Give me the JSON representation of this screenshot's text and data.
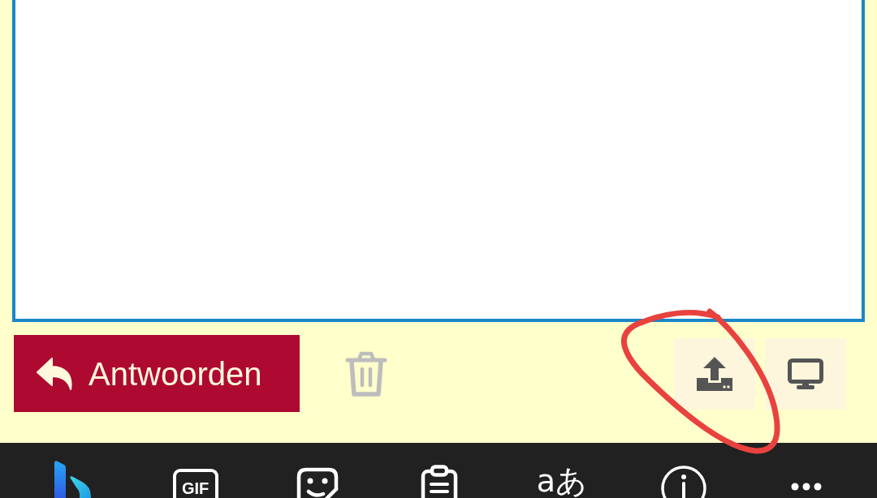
{
  "message_field": {
    "focused": true
  },
  "actions": [
    {
      "kind": "reply",
      "label": "Antwoorden"
    },
    {
      "kind": "delete",
      "disabled": true
    }
  ],
  "tools": [
    {
      "kind": "upload"
    },
    {
      "kind": "screen"
    }
  ],
  "annotations": [
    {
      "kind": "loop"
    }
  ],
  "keyboard_toolbar": [
    {
      "kind": "logo"
    },
    {
      "kind": "gif",
      "label": "GIF"
    },
    {
      "kind": "sticker"
    },
    {
      "kind": "clipboard"
    },
    {
      "kind": "translate",
      "label": "aあ"
    },
    {
      "kind": "info"
    },
    {
      "kind": "more"
    }
  ]
}
